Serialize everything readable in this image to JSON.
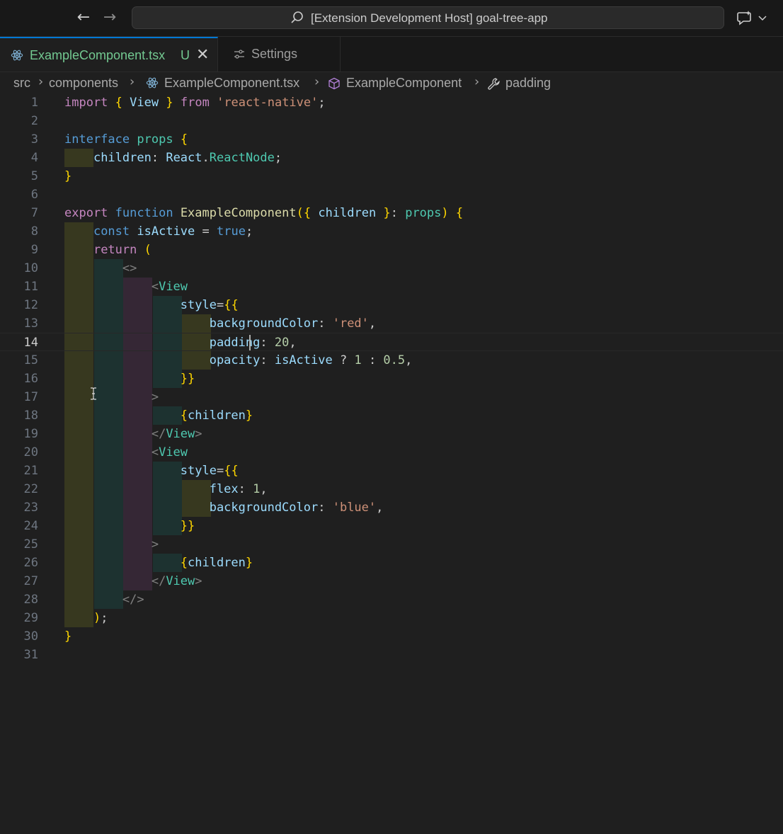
{
  "titlebar": {
    "back_icon": "arrow-left-icon",
    "forward_icon": "arrow-right-icon",
    "command_center": "[Extension Development Host] goal-tree-app"
  },
  "tabs": [
    {
      "label": "ExampleComponent.tsx",
      "status": "U",
      "icon": "react-icon"
    },
    {
      "label": "Settings",
      "icon": "settings-sliders-icon"
    }
  ],
  "breadcrumb": [
    "src",
    "components",
    "ExampleComponent.tsx",
    "ExampleComponent",
    "padding"
  ],
  "editor": {
    "current_line": 14,
    "line_numbers": [
      "1",
      "2",
      "3",
      "4",
      "5",
      "6",
      "7",
      "8",
      "9",
      "10",
      "11",
      "12",
      "13",
      "14",
      "15",
      "16",
      "17",
      "18",
      "19",
      "20",
      "21",
      "22",
      "23",
      "24",
      "25",
      "26",
      "27",
      "28",
      "29",
      "30",
      "31"
    ],
    "code": [
      "import { View } from 'react-native';",
      "",
      "interface props {",
      "    children: React.ReactNode;",
      "}",
      "",
      "export function ExampleComponent({ children }: props) {",
      "    const isActive = true;",
      "    return (",
      "        <>",
      "            <View",
      "                style={{",
      "                    backgroundColor: 'red',",
      "                    padding: 20,",
      "                    opacity: isActive ? 1 : 0.5,",
      "                }}",
      "            >",
      "                {children}",
      "            </View>",
      "            <View",
      "                style={{",
      "                    flex: 1,",
      "                    backgroundColor: 'blue',",
      "                }}",
      "            >",
      "                {children}",
      "            </View>",
      "        </>",
      "    );",
      "}",
      ""
    ]
  },
  "colors": {
    "accent": "#0078d4",
    "untracked": "#73c991",
    "background": "#1f1f1f"
  }
}
